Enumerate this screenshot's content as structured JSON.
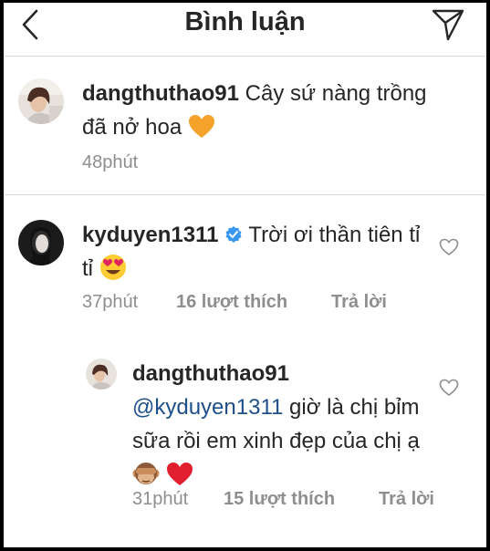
{
  "header": {
    "title": "Bình luận"
  },
  "caption": {
    "username": "dangthuthao91",
    "text": "Cây sứ nàng trồng đã nở hoa",
    "emoji": "orange-heart",
    "time": "48phút"
  },
  "comments": [
    {
      "username": "kyduyen1311",
      "verified": true,
      "text": "Trời ơi thần tiên tỉ tỉ",
      "emoji": "heart-eyes-face",
      "time": "37phút",
      "likes": "16 lượt thích",
      "reply_label": "Trả lời"
    },
    {
      "username": "dangthuthao91",
      "mention": "@kyduyen1311",
      "text": "giờ là chị bỉm sữa rồi em xinh đẹp của chị ạ",
      "emojis": [
        "see-no-evil-monkey",
        "red-heart"
      ],
      "time": "31phút",
      "likes": "15 lượt thích",
      "reply_label": "Trả lời"
    }
  ],
  "colors": {
    "text": "#262626",
    "meta": "#8e8e8e",
    "mention": "#1e4f8a",
    "verified": "#3897f0",
    "divider": "#dbdbdb"
  }
}
